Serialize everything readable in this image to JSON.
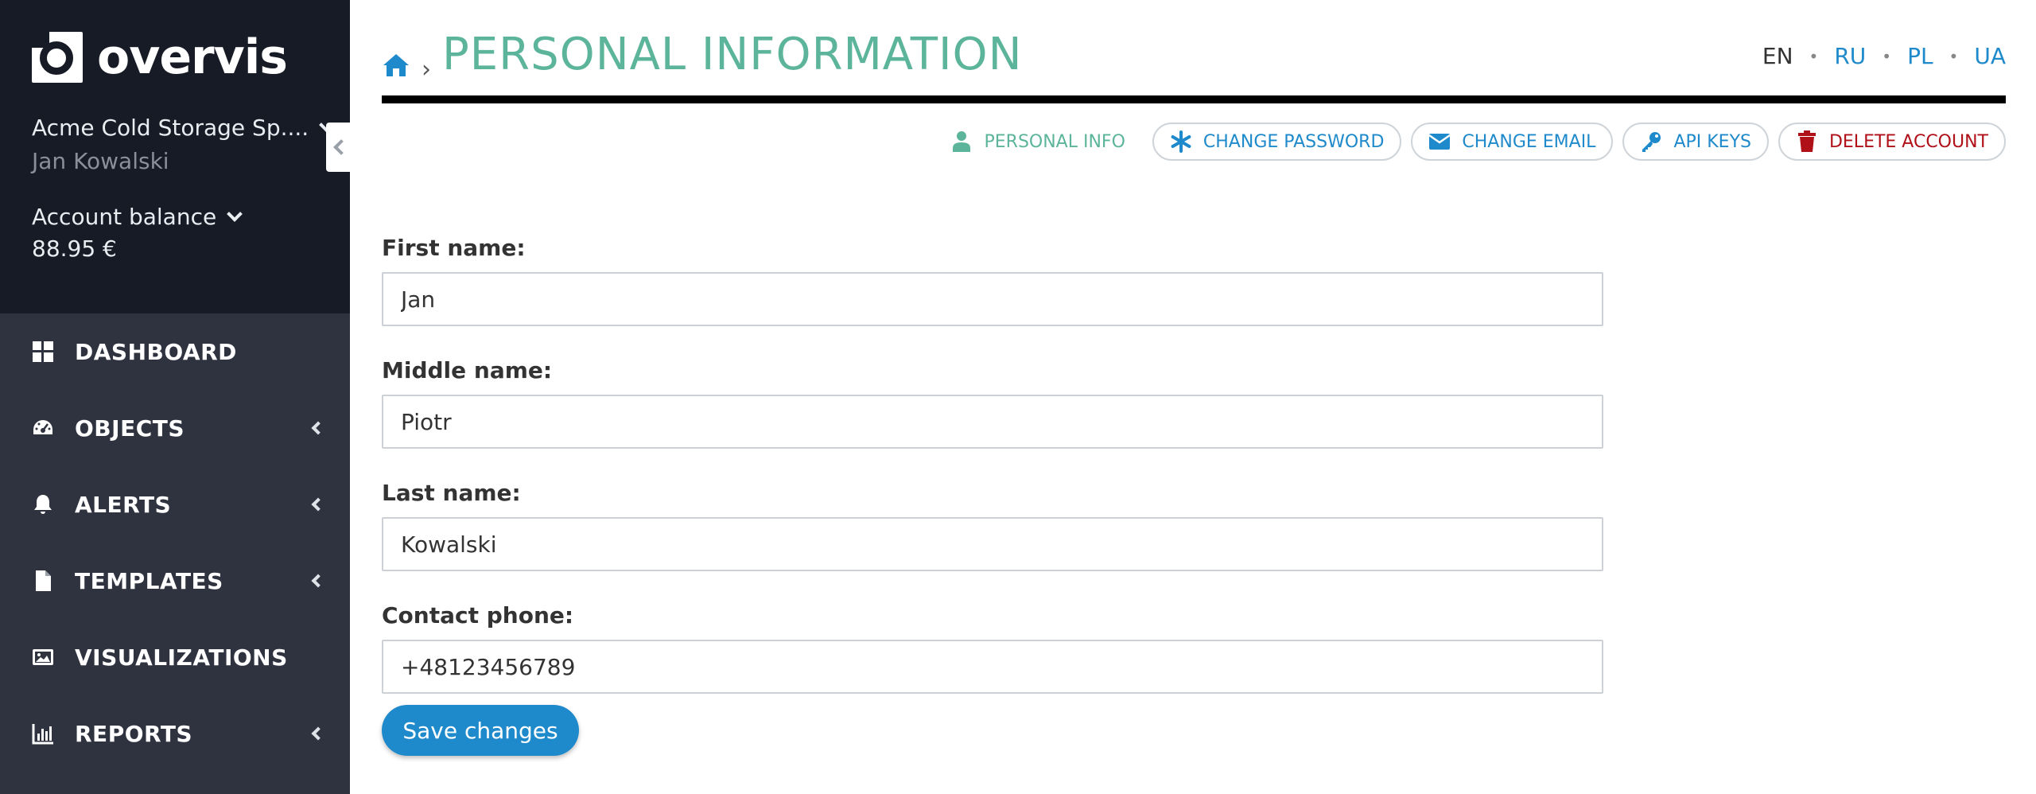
{
  "sidebar": {
    "logo_text": "overvis",
    "company": "Acme Cold Storage Sp....",
    "user": "Jan Kowalski",
    "balance_label": "Account balance",
    "balance_value": "88.95 €",
    "items": [
      {
        "label": "DASHBOARD",
        "icon": "grid-icon",
        "has_submenu": false
      },
      {
        "label": "OBJECTS",
        "icon": "gauge-icon",
        "has_submenu": true
      },
      {
        "label": "ALERTS",
        "icon": "bell-icon",
        "has_submenu": true
      },
      {
        "label": "TEMPLATES",
        "icon": "file-icon",
        "has_submenu": true
      },
      {
        "label": "VISUALIZATIONS",
        "icon": "image-icon",
        "has_submenu": false
      },
      {
        "label": "REPORTS",
        "icon": "bar-chart-icon",
        "has_submenu": true
      }
    ]
  },
  "header": {
    "title": "PERSONAL INFORMATION",
    "languages": [
      {
        "code": "EN",
        "active": true
      },
      {
        "code": "RU",
        "active": false
      },
      {
        "code": "PL",
        "active": false
      },
      {
        "code": "UA",
        "active": false
      }
    ]
  },
  "tabs": [
    {
      "label": "PERSONAL INFO",
      "icon": "user-icon"
    },
    {
      "label": "CHANGE PASSWORD",
      "icon": "asterisk-icon"
    },
    {
      "label": "CHANGE EMAIL",
      "icon": "envelope-icon"
    },
    {
      "label": "API KEYS",
      "icon": "key-icon"
    },
    {
      "label": "DELETE ACCOUNT",
      "icon": "trash-icon"
    }
  ],
  "form": {
    "first_name": {
      "label": "First name:",
      "value": "Jan"
    },
    "middle_name": {
      "label": "Middle name:",
      "value": "Piotr"
    },
    "last_name": {
      "label": "Last name:",
      "value": "Kowalski"
    },
    "phone": {
      "label": "Contact phone:",
      "value": "+48123456789"
    },
    "save_label": "Save changes"
  },
  "colors": {
    "sidebar_bg": "#2f3340",
    "sidebar_top_bg": "#171b26",
    "title": "#5cb59a",
    "link": "#1f8acb",
    "danger": "#b01018"
  }
}
